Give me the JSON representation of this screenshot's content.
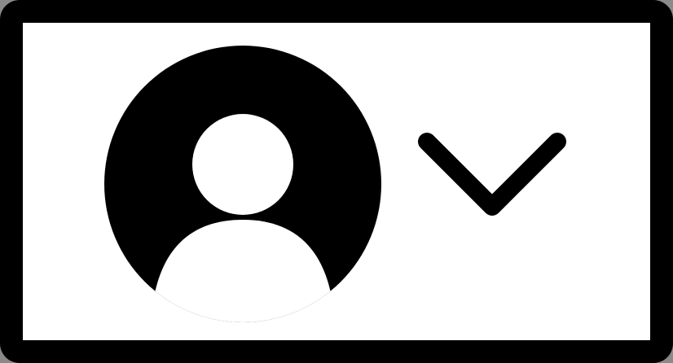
{
  "widget": {
    "type": "account-menu-button",
    "icons": {
      "avatar": "user-circle-icon",
      "dropdown": "chevron-down-icon"
    }
  },
  "colors": {
    "background": "#8a8a8a",
    "frame": "#000000",
    "surface": "#ffffff",
    "icon": "#000000"
  }
}
